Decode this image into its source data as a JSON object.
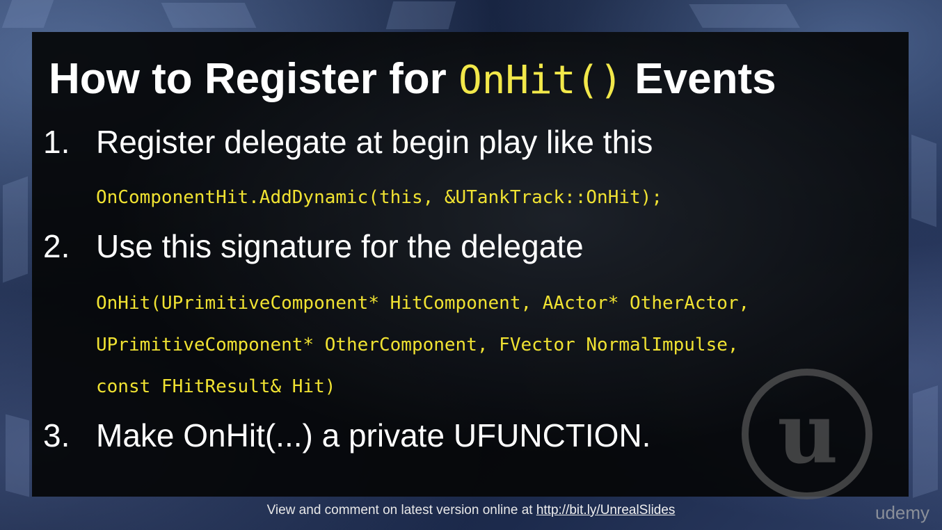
{
  "slide": {
    "title": {
      "before": "How to Register for ",
      "code": "OnHit()",
      "after": " Events"
    },
    "steps": [
      {
        "number": "1.",
        "text": "Register delegate at begin play like this"
      },
      {
        "number": "2.",
        "text": "Use this signature for the delegate"
      },
      {
        "number": "3.",
        "text": "Make OnHit(...) a private UFUNCTION."
      }
    ],
    "code_step1": "OnComponentHit.AddDynamic(this, &UTankTrack::OnHit);",
    "code_step2": [
      "OnHit(UPrimitiveComponent* HitComponent, AActor* OtherActor,",
      "UPrimitiveComponent* OtherComponent, FVector NormalImpulse,",
      "const FHitResult& Hit)"
    ]
  },
  "footer": {
    "text": "View and comment on latest version online at ",
    "link": "http://bit.ly/UnrealSlides"
  },
  "brand": "udemy",
  "colors": {
    "code": "#f0e232",
    "title": "#ffffff",
    "panel": "#050608"
  },
  "icons": {
    "logo": "unreal-engine-logo-icon"
  }
}
